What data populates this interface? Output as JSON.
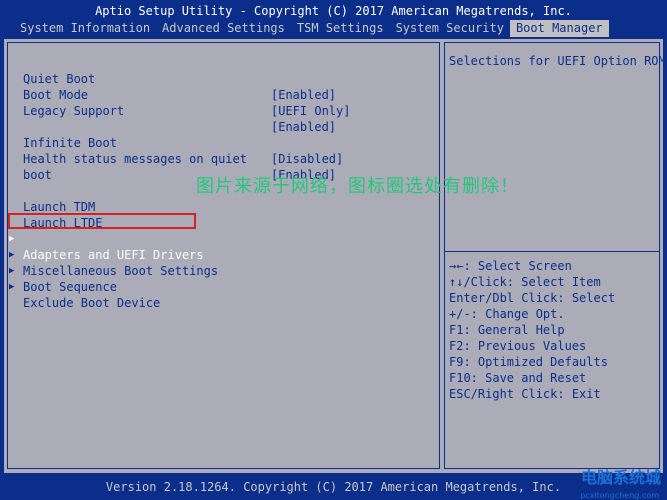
{
  "title": "Aptio Setup Utility - Copyright (C) 2017 American Megatrends, Inc.",
  "tabs": [
    {
      "label": "System Information"
    },
    {
      "label": "Advanced Settings"
    },
    {
      "label": "TSM Settings"
    },
    {
      "label": "System Security"
    },
    {
      "label": "Boot Manager"
    }
  ],
  "settings": {
    "quiet_boot": {
      "label": "Quiet Boot",
      "value": "[Enabled]"
    },
    "boot_mode": {
      "label": "Boot Mode",
      "value": "[UEFI Only]"
    },
    "legacy_support": {
      "label": "Legacy Support",
      "value": "[Enabled]"
    },
    "infinite_boot": {
      "label": "Infinite Boot",
      "value": "[Disabled]"
    },
    "health_status": {
      "label_line1": "Health status messages on quiet",
      "label_line2": "boot",
      "value": "[Enabled]"
    },
    "launch_tdm": {
      "label": "Launch TDM"
    },
    "launch_ltde": {
      "label": "Launch LTDE"
    }
  },
  "submenus": [
    {
      "label": "Adapters and UEFI Drivers"
    },
    {
      "label": "Miscellaneous Boot Settings"
    },
    {
      "label": "Boot Sequence"
    },
    {
      "label": "Exclude Boot Device"
    }
  ],
  "help": {
    "description": "Selections for UEFI Option ROM"
  },
  "keys": [
    {
      "text": "→←: Select Screen"
    },
    {
      "text": "↑↓/Click: Select Item"
    },
    {
      "text": "Enter/Dbl Click: Select"
    },
    {
      "text": "+/-: Change Opt."
    },
    {
      "text": "F1: General Help"
    },
    {
      "text": "F2: Previous Values"
    },
    {
      "text": "F9: Optimized Defaults"
    },
    {
      "text": "F10: Save and Reset"
    },
    {
      "text": "ESC/Right Click: Exit"
    }
  ],
  "overlay": {
    "text": "图片来源于网络，图标圈选处有删除！"
  },
  "watermark": {
    "brand": "电脑系统城",
    "url": "pcxitongcheng.com"
  },
  "statusbar": "Version 2.18.1264. Copyright (C) 2017 American Megatrends, Inc.",
  "colors": {
    "background": "#0b2e8a",
    "panel": "#acacb8",
    "highlight_border": "#d22424",
    "overlay_text": "#22c87a",
    "watermark": "#1e6fd6"
  }
}
